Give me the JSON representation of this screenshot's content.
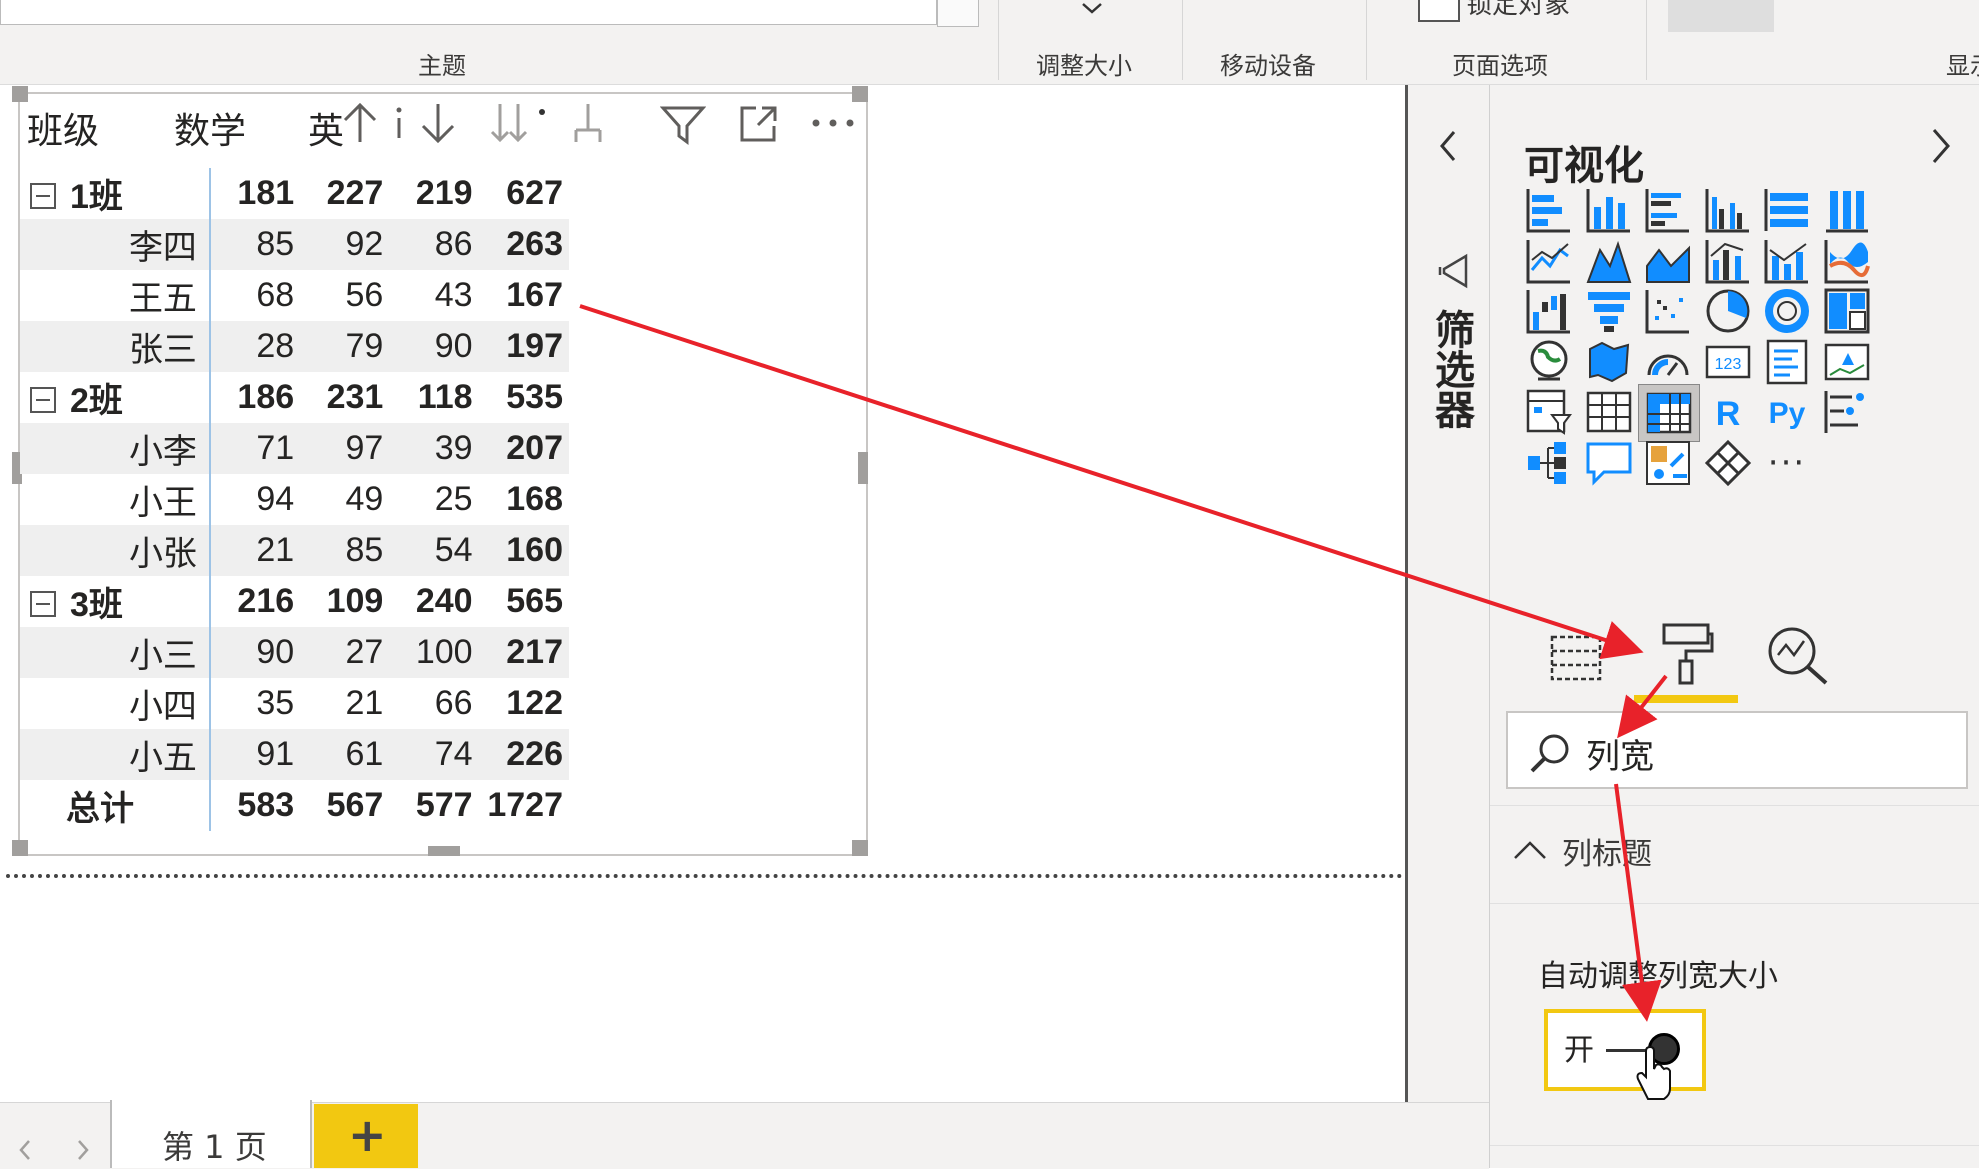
{
  "ribbon": {
    "groups": [
      "主题",
      "调整大小",
      "移动设备",
      "页面选项",
      "显示"
    ],
    "lock_objects_label": "锁定对象"
  },
  "visual": {
    "headers": [
      "班级",
      "数学",
      "英"
    ],
    "header_icons": [
      "sort-ascending-icon",
      "sort-descending-icon",
      "expand-all-icon",
      "expand-level-icon",
      "filter-icon",
      "focus-mode-icon",
      "more-options-icon"
    ]
  },
  "matrix": {
    "rows": [
      {
        "type": "group",
        "label": "1班",
        "values": [
          "181",
          "227",
          "219"
        ],
        "total": "627"
      },
      {
        "type": "child",
        "label": "李四",
        "values": [
          "85",
          "92",
          "86"
        ],
        "total": "263"
      },
      {
        "type": "child",
        "label": "王五",
        "values": [
          "68",
          "56",
          "43"
        ],
        "total": "167"
      },
      {
        "type": "child",
        "label": "张三",
        "values": [
          "28",
          "79",
          "90"
        ],
        "total": "197"
      },
      {
        "type": "group",
        "label": "2班",
        "values": [
          "186",
          "231",
          "118"
        ],
        "total": "535"
      },
      {
        "type": "child",
        "label": "小李",
        "values": [
          "71",
          "97",
          "39"
        ],
        "total": "207"
      },
      {
        "type": "child",
        "label": "小王",
        "values": [
          "94",
          "49",
          "25"
        ],
        "total": "168"
      },
      {
        "type": "child",
        "label": "小张",
        "values": [
          "21",
          "85",
          "54"
        ],
        "total": "160"
      },
      {
        "type": "group",
        "label": "3班",
        "values": [
          "216",
          "109",
          "240"
        ],
        "total": "565"
      },
      {
        "type": "child",
        "label": "小三",
        "values": [
          "90",
          "27",
          "100"
        ],
        "total": "217"
      },
      {
        "type": "child",
        "label": "小四",
        "values": [
          "35",
          "21",
          "66"
        ],
        "total": "122"
      },
      {
        "type": "child",
        "label": "小五",
        "values": [
          "91",
          "61",
          "74"
        ],
        "total": "226"
      },
      {
        "type": "total",
        "label": "总计",
        "values": [
          "583",
          "567",
          "577"
        ],
        "total": "1727"
      }
    ]
  },
  "filters_pane": {
    "title": "筛选器"
  },
  "viz_pane": {
    "title": "可视化",
    "search_value": "列宽",
    "section_title": "列标题",
    "setting_label": "自动调整列宽大小",
    "toggle_label": "开",
    "r_label": "R",
    "py_label": "Py",
    "more_label": "···",
    "accent_color": "#f2c811",
    "chart_blue": "#118dff"
  },
  "pages": {
    "tab_label": "第 1 页",
    "add_label": "+"
  }
}
